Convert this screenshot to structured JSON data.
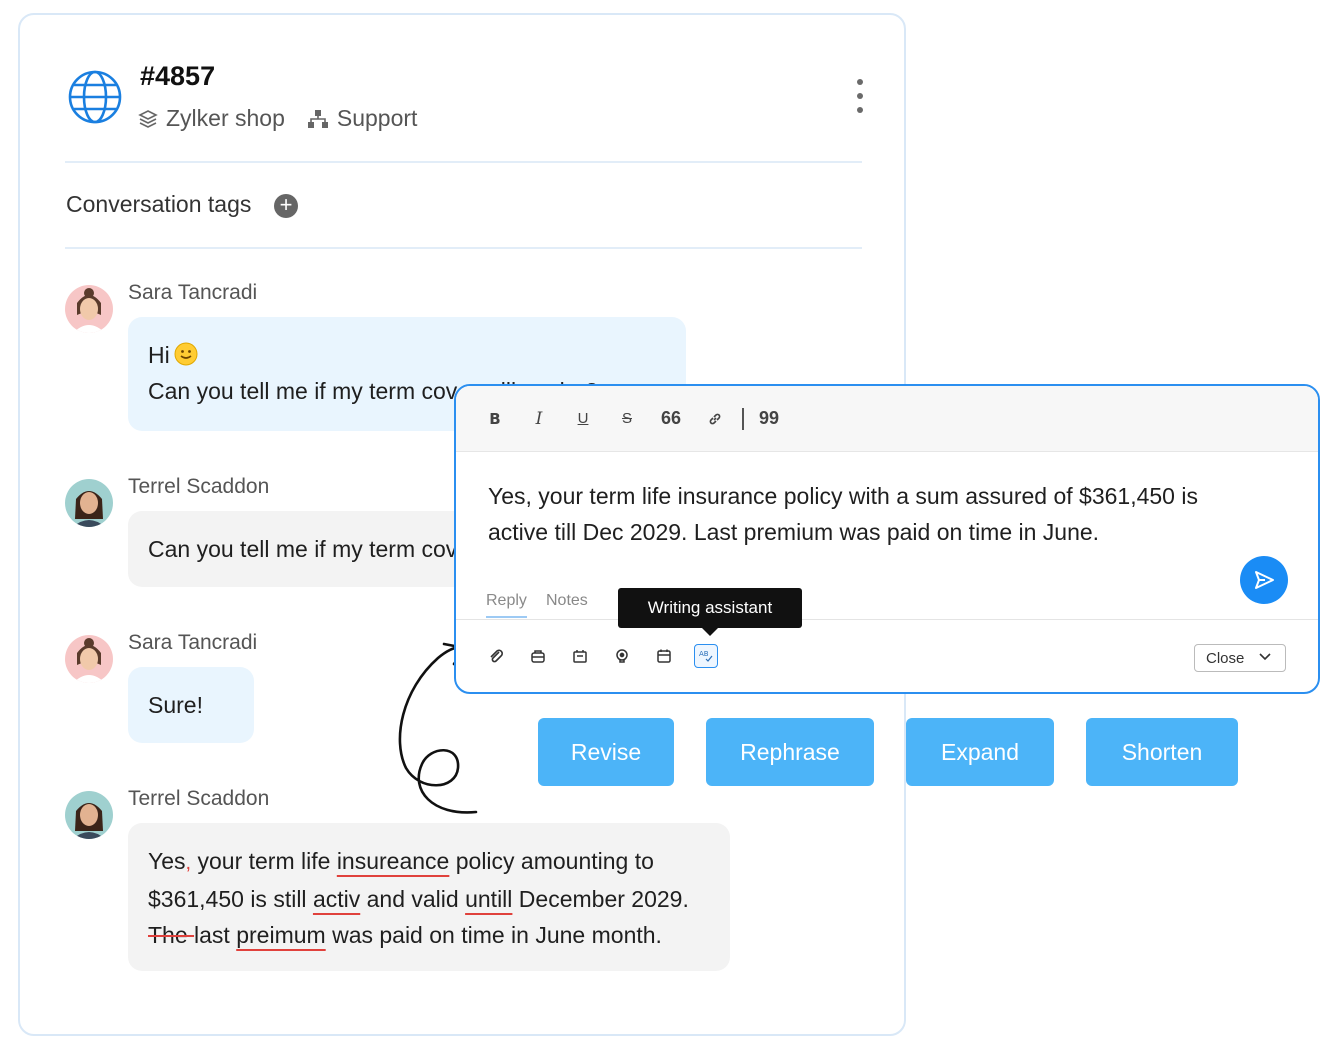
{
  "ticket": {
    "id": "#4857",
    "brand": "Zylker shop",
    "department": "Support",
    "icons": {
      "channel": "globe-icon",
      "brand": "layers-icon",
      "department": "org-chart-icon",
      "menu": "kebab-menu-icon"
    }
  },
  "tags": {
    "label": "Conversation tags",
    "add_icon": "plus-circle-icon"
  },
  "messages": [
    {
      "sender": "Sara Tancradi",
      "style": "customer",
      "lines": [
        "Hi",
        "Can you tell me if my term cover will expire?"
      ],
      "emoji": "slightly-smiling-face"
    },
    {
      "sender": "Terrel Scaddon",
      "style": "agent",
      "lines": [
        "Can you tell me if my term cover will expire?"
      ]
    },
    {
      "sender": "Sara Tancradi",
      "style": "customer",
      "lines": [
        "Sure!"
      ]
    },
    {
      "sender": "Terrel Scaddon",
      "style": "agent",
      "draft": {
        "w1": "Yes",
        "w1_mark": ",",
        "w2": " your term life ",
        "w3": "insureance",
        "w4": " policy amounting to",
        "w5": "$361,450 is still ",
        "w6": "activ",
        "w7": " and valid ",
        "w8": "untill",
        "w9": " December 2029.",
        "w10": "The ",
        "w11": "last ",
        "w12": "preimum",
        "w13": " was paid on time in June month."
      }
    }
  ],
  "editor": {
    "toolbar": [
      "B",
      "I",
      "U",
      "S",
      "66",
      "link",
      "99"
    ],
    "text": [
      "Yes, your term life insurance policy with a sum assured of $361,450 is",
      "active till Dec 2029. Last premium was paid on time in June."
    ],
    "tabs": {
      "reply": "Reply",
      "notes": "Notes"
    },
    "tooltip": "Writing assistant",
    "status_select": "Close",
    "bottom_icons": [
      "paperclip-icon",
      "knowledge-base-icon",
      "template-icon",
      "ai-bulb-icon",
      "calendar-icon",
      "writing-assistant-icon"
    ],
    "send_icon": "send-icon"
  },
  "actions": {
    "revise": "Revise",
    "rephrase": "Rephrase",
    "expand": "Expand",
    "shorten": "Shorten"
  },
  "colors": {
    "accent": "#1a8cf5",
    "action_button": "#4cb4f8",
    "error_underline": "#e0413c",
    "customer_bubble": "#e9f5fe",
    "agent_bubble": "#f3f3f3"
  }
}
